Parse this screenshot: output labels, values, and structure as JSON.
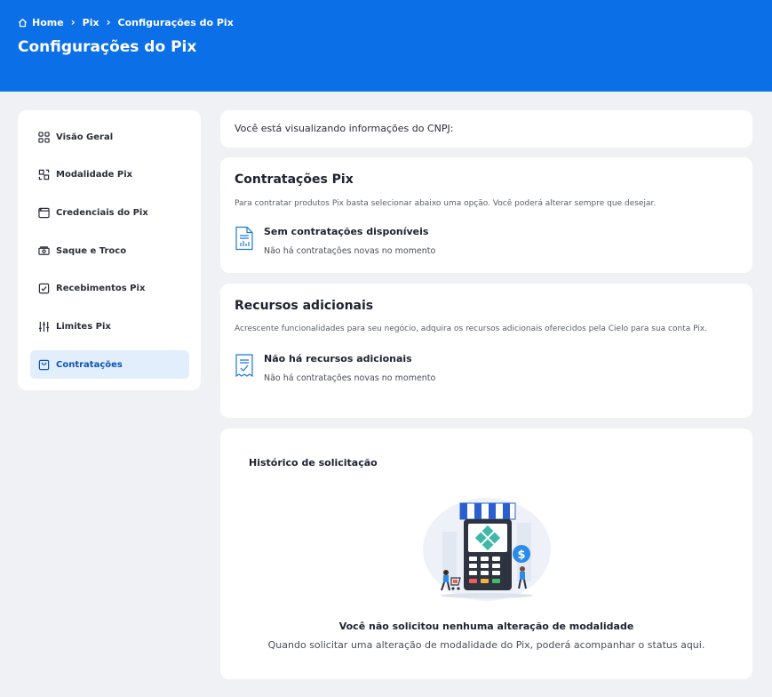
{
  "breadcrumb": {
    "home": "Home",
    "pix": "Pix",
    "current": "Configurações do Pix"
  },
  "page_title": "Configurações do Pix",
  "sidebar": {
    "items": [
      {
        "label": "Visão Geral",
        "icon": "grid-icon"
      },
      {
        "label": "Modalidade Pix",
        "icon": "swap-icon"
      },
      {
        "label": "Credenciais do Pix",
        "icon": "window-icon"
      },
      {
        "label": "Saque e Troco",
        "icon": "cash-icon"
      },
      {
        "label": "Recebimentos Pix",
        "icon": "check-doc-icon"
      },
      {
        "label": "Limites Pix",
        "icon": "sliders-icon"
      },
      {
        "label": "Contratações",
        "icon": "bag-icon",
        "active": true
      }
    ]
  },
  "cnpj_card": {
    "text": "Você está visualizando informações do CNPJ:"
  },
  "contratacoes": {
    "title": "Contratações Pix",
    "description": "Para contratar produtos Pix basta selecionar abaixo uma opção. Você poderá alterar sempre que desejar.",
    "empty_title": "Sem contratações disponíveis",
    "empty_subtitle": "Não há contratações novas no momento"
  },
  "recursos": {
    "title": "Recursos adicionais",
    "description": "Acrescente funcionalidades para seu negócio, adquira os recursos adicionais oferecidos pela Cielo para sua conta Pix.",
    "empty_title": "Não há recursos adicionais",
    "empty_subtitle": "Não há contratações novas no momento"
  },
  "historico": {
    "title": "Histórico de solicitação",
    "empty_title": "Você não solicitou nenhuma alteração de modalidade",
    "empty_subtitle": "Quando solicitar uma alteração de modalidade do Pix, poderá acompanhar o status aqui."
  },
  "colors": {
    "header": "#0b6fe8",
    "active_bg": "#e3eefc",
    "active_text": "#0b54b9",
    "background": "#eff1f4"
  }
}
